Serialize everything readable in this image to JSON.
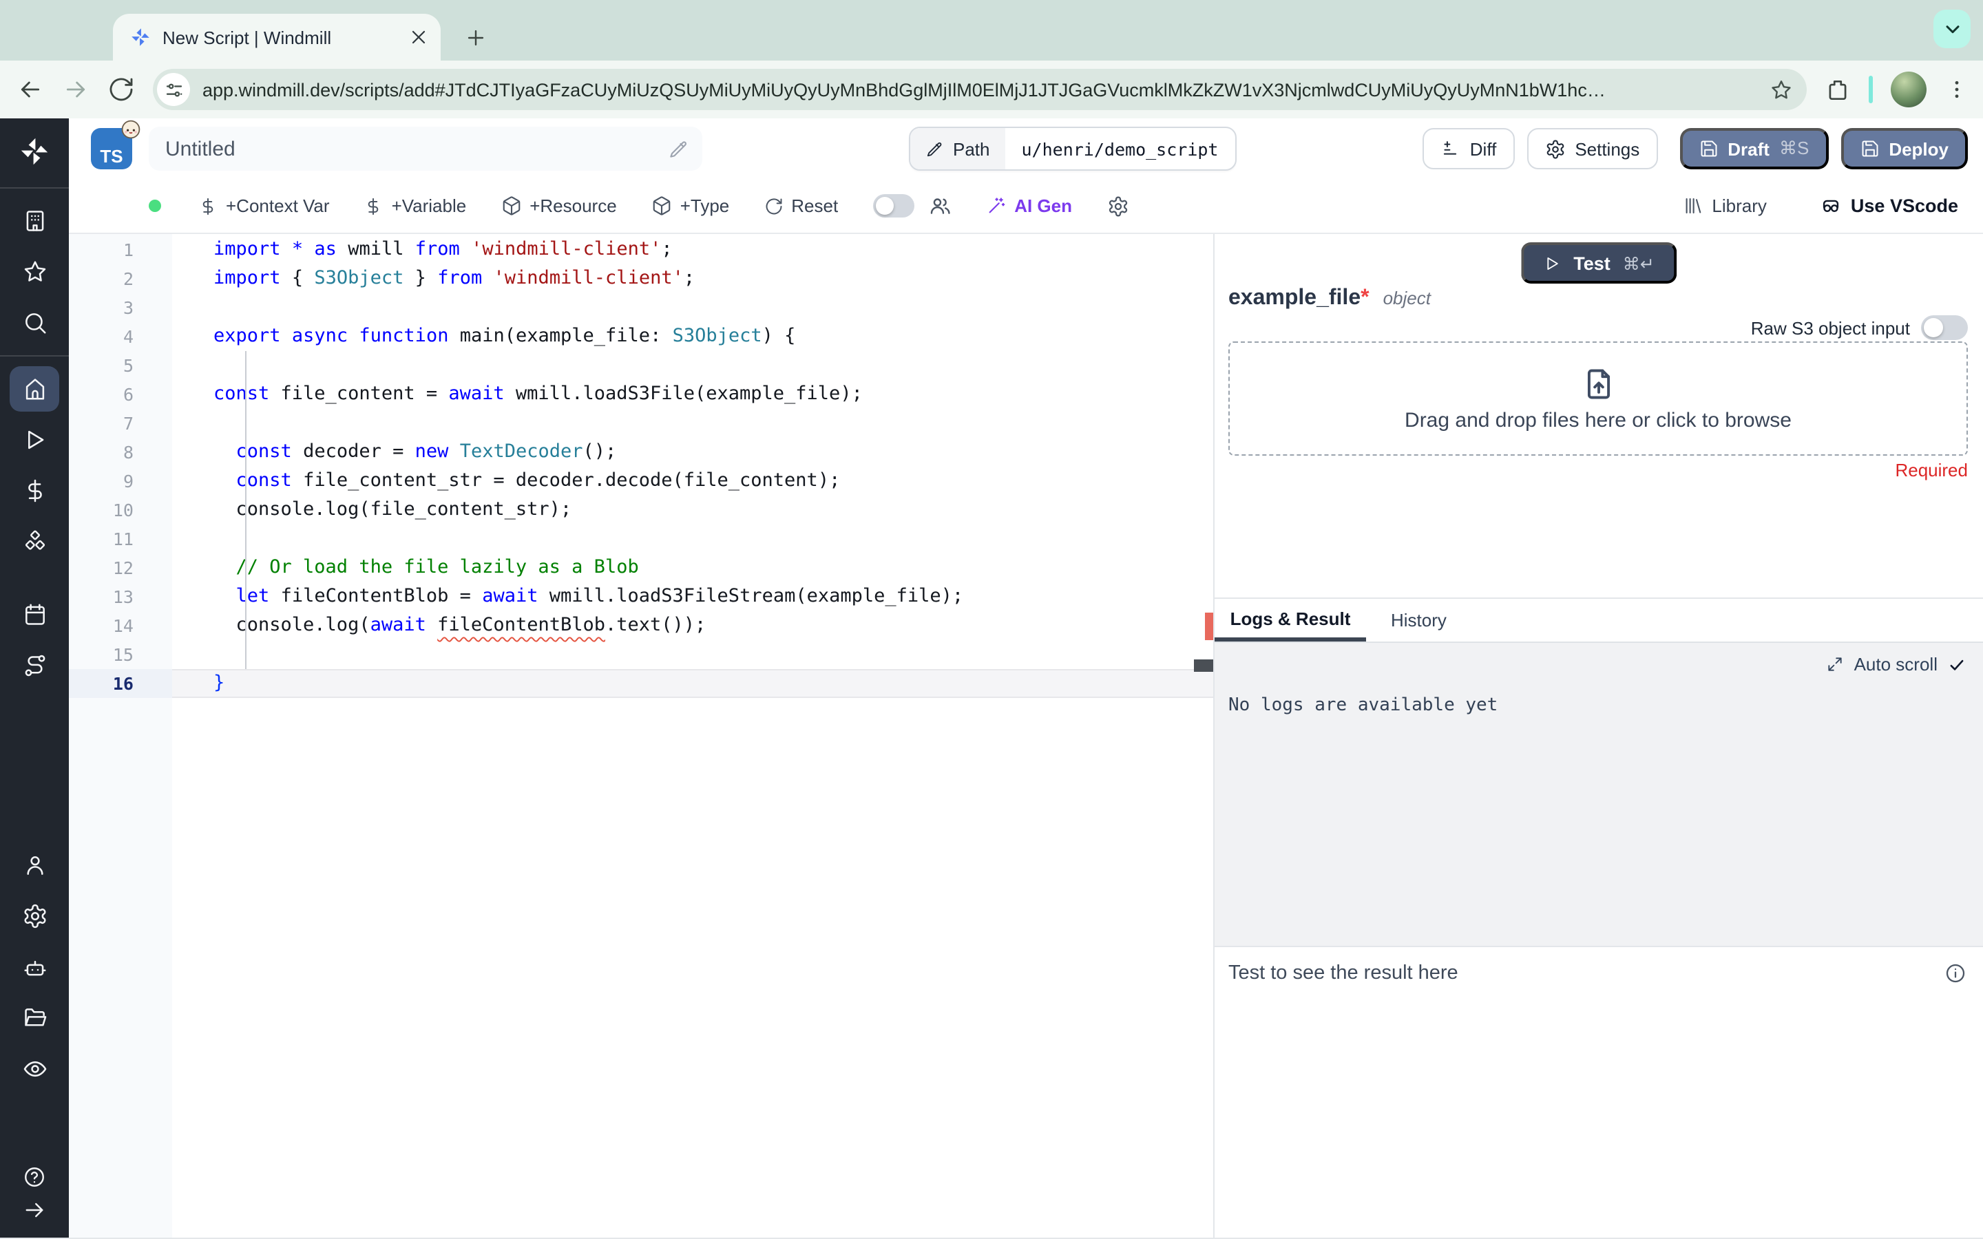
{
  "browser": {
    "tab_title": "New Script | Windmill",
    "url": "app.windmill.dev/scripts/add#JTdCJTIyaGFzaCUyMiUzQSUyMiUyMiUyQyUyMnBhdGglMjIlM0ElMjJ1JTJGaGVucmklMkZkZW1vX3NjcmlwdCUyMiUyQyUyMnN1bW1hc…"
  },
  "header": {
    "lang_badge": "TS",
    "script_title": "Untitled",
    "path_label": "Path",
    "path_value": "u/henri/demo_script",
    "diff_label": "Diff",
    "settings_label": "Settings",
    "draft_label": "Draft",
    "draft_shortcut": "⌘S",
    "deploy_label": "Deploy"
  },
  "toolbar": {
    "context_var": "+Context Var",
    "variable": "+Variable",
    "resource": "+Resource",
    "type": "+Type",
    "reset": "Reset",
    "ai_gen": "AI Gen",
    "library": "Library",
    "use_vscode": "Use VScode"
  },
  "editor": {
    "lines": [
      [
        [
          "kw",
          "import"
        ],
        [
          "pl",
          " "
        ],
        [
          "kw",
          "*"
        ],
        [
          "pl",
          " "
        ],
        [
          "kw",
          "as"
        ],
        [
          "pl",
          " wmill "
        ],
        [
          "kw",
          "from"
        ],
        [
          "pl",
          " "
        ],
        [
          "str",
          "'windmill-client'"
        ],
        [
          "pl",
          ";"
        ]
      ],
      [
        [
          "kw",
          "import"
        ],
        [
          "pl",
          " { "
        ],
        [
          "ty",
          "S3Object"
        ],
        [
          "pl",
          " } "
        ],
        [
          "kw",
          "from"
        ],
        [
          "pl",
          " "
        ],
        [
          "str",
          "'windmill-client'"
        ],
        [
          "pl",
          ";"
        ]
      ],
      [],
      [
        [
          "kw",
          "export"
        ],
        [
          "pl",
          " "
        ],
        [
          "kw",
          "async"
        ],
        [
          "pl",
          " "
        ],
        [
          "kw",
          "function"
        ],
        [
          "pl",
          " main(example_file: "
        ],
        [
          "ty",
          "S3Object"
        ],
        [
          "pl",
          ") {"
        ]
      ],
      [],
      [
        [
          "kw",
          "const"
        ],
        [
          "pl",
          " file_content = "
        ],
        [
          "kw",
          "await"
        ],
        [
          "pl",
          " wmill.loadS3File(example_file);"
        ]
      ],
      [],
      [
        [
          "pl",
          "  "
        ],
        [
          "kw",
          "const"
        ],
        [
          "pl",
          " decoder = "
        ],
        [
          "kw",
          "new"
        ],
        [
          "pl",
          " "
        ],
        [
          "ty",
          "TextDecoder"
        ],
        [
          "pl",
          "();"
        ]
      ],
      [
        [
          "pl",
          "  "
        ],
        [
          "kw",
          "const"
        ],
        [
          "pl",
          " file_content_str = decoder.decode(file_content);"
        ]
      ],
      [
        [
          "pl",
          "  console.log(file_content_str);"
        ]
      ],
      [],
      [
        [
          "co",
          "  // Or load the file lazily as a Blob"
        ]
      ],
      [
        [
          "pl",
          "  "
        ],
        [
          "kw",
          "let"
        ],
        [
          "pl",
          " fileContentBlob = "
        ],
        [
          "kw",
          "await"
        ],
        [
          "pl",
          " wmill.loadS3FileStream(example_file);"
        ]
      ],
      [
        [
          "pl",
          "  console.log("
        ],
        [
          "kw",
          "await"
        ],
        [
          "pl",
          " "
        ],
        [
          "er",
          "fileContentBlob"
        ],
        [
          "pl",
          ".text());"
        ]
      ],
      [],
      [
        [
          "br",
          "}"
        ]
      ]
    ]
  },
  "test_panel": {
    "test_label": "Test",
    "test_shortcut": "⌘↵",
    "arg_name": "example_file",
    "required_star": "*",
    "arg_type": "object",
    "raw_s3_label": "Raw S3 object input",
    "dropzone_text": "Drag and drop files here or click to browse",
    "required_label": "Required"
  },
  "logs_panel": {
    "tab_logs": "Logs & Result",
    "tab_history": "History",
    "auto_scroll": "Auto scroll",
    "no_logs": "No logs are available yet",
    "result_placeholder": "Test to see the result here"
  },
  "sidebar_icons": [
    "windmill-logo",
    "buildings",
    "star",
    "search",
    "home",
    "play",
    "dollar",
    "boxes",
    "calendar",
    "route",
    "user",
    "gear",
    "bot",
    "folder-open",
    "eye",
    "help",
    "arrow-right"
  ],
  "colors": {
    "accent_button": "#66799e",
    "test_button": "#3d4960",
    "sidebar_bg": "#21262e",
    "ai_purple": "#7c3aed",
    "error_red": "#dc2626",
    "ws_green_dot": "#4ade80",
    "chrome_bg": "#cfe0da",
    "chrome_surface": "#f2f7f4",
    "mint_button": "#b9f6e9"
  }
}
